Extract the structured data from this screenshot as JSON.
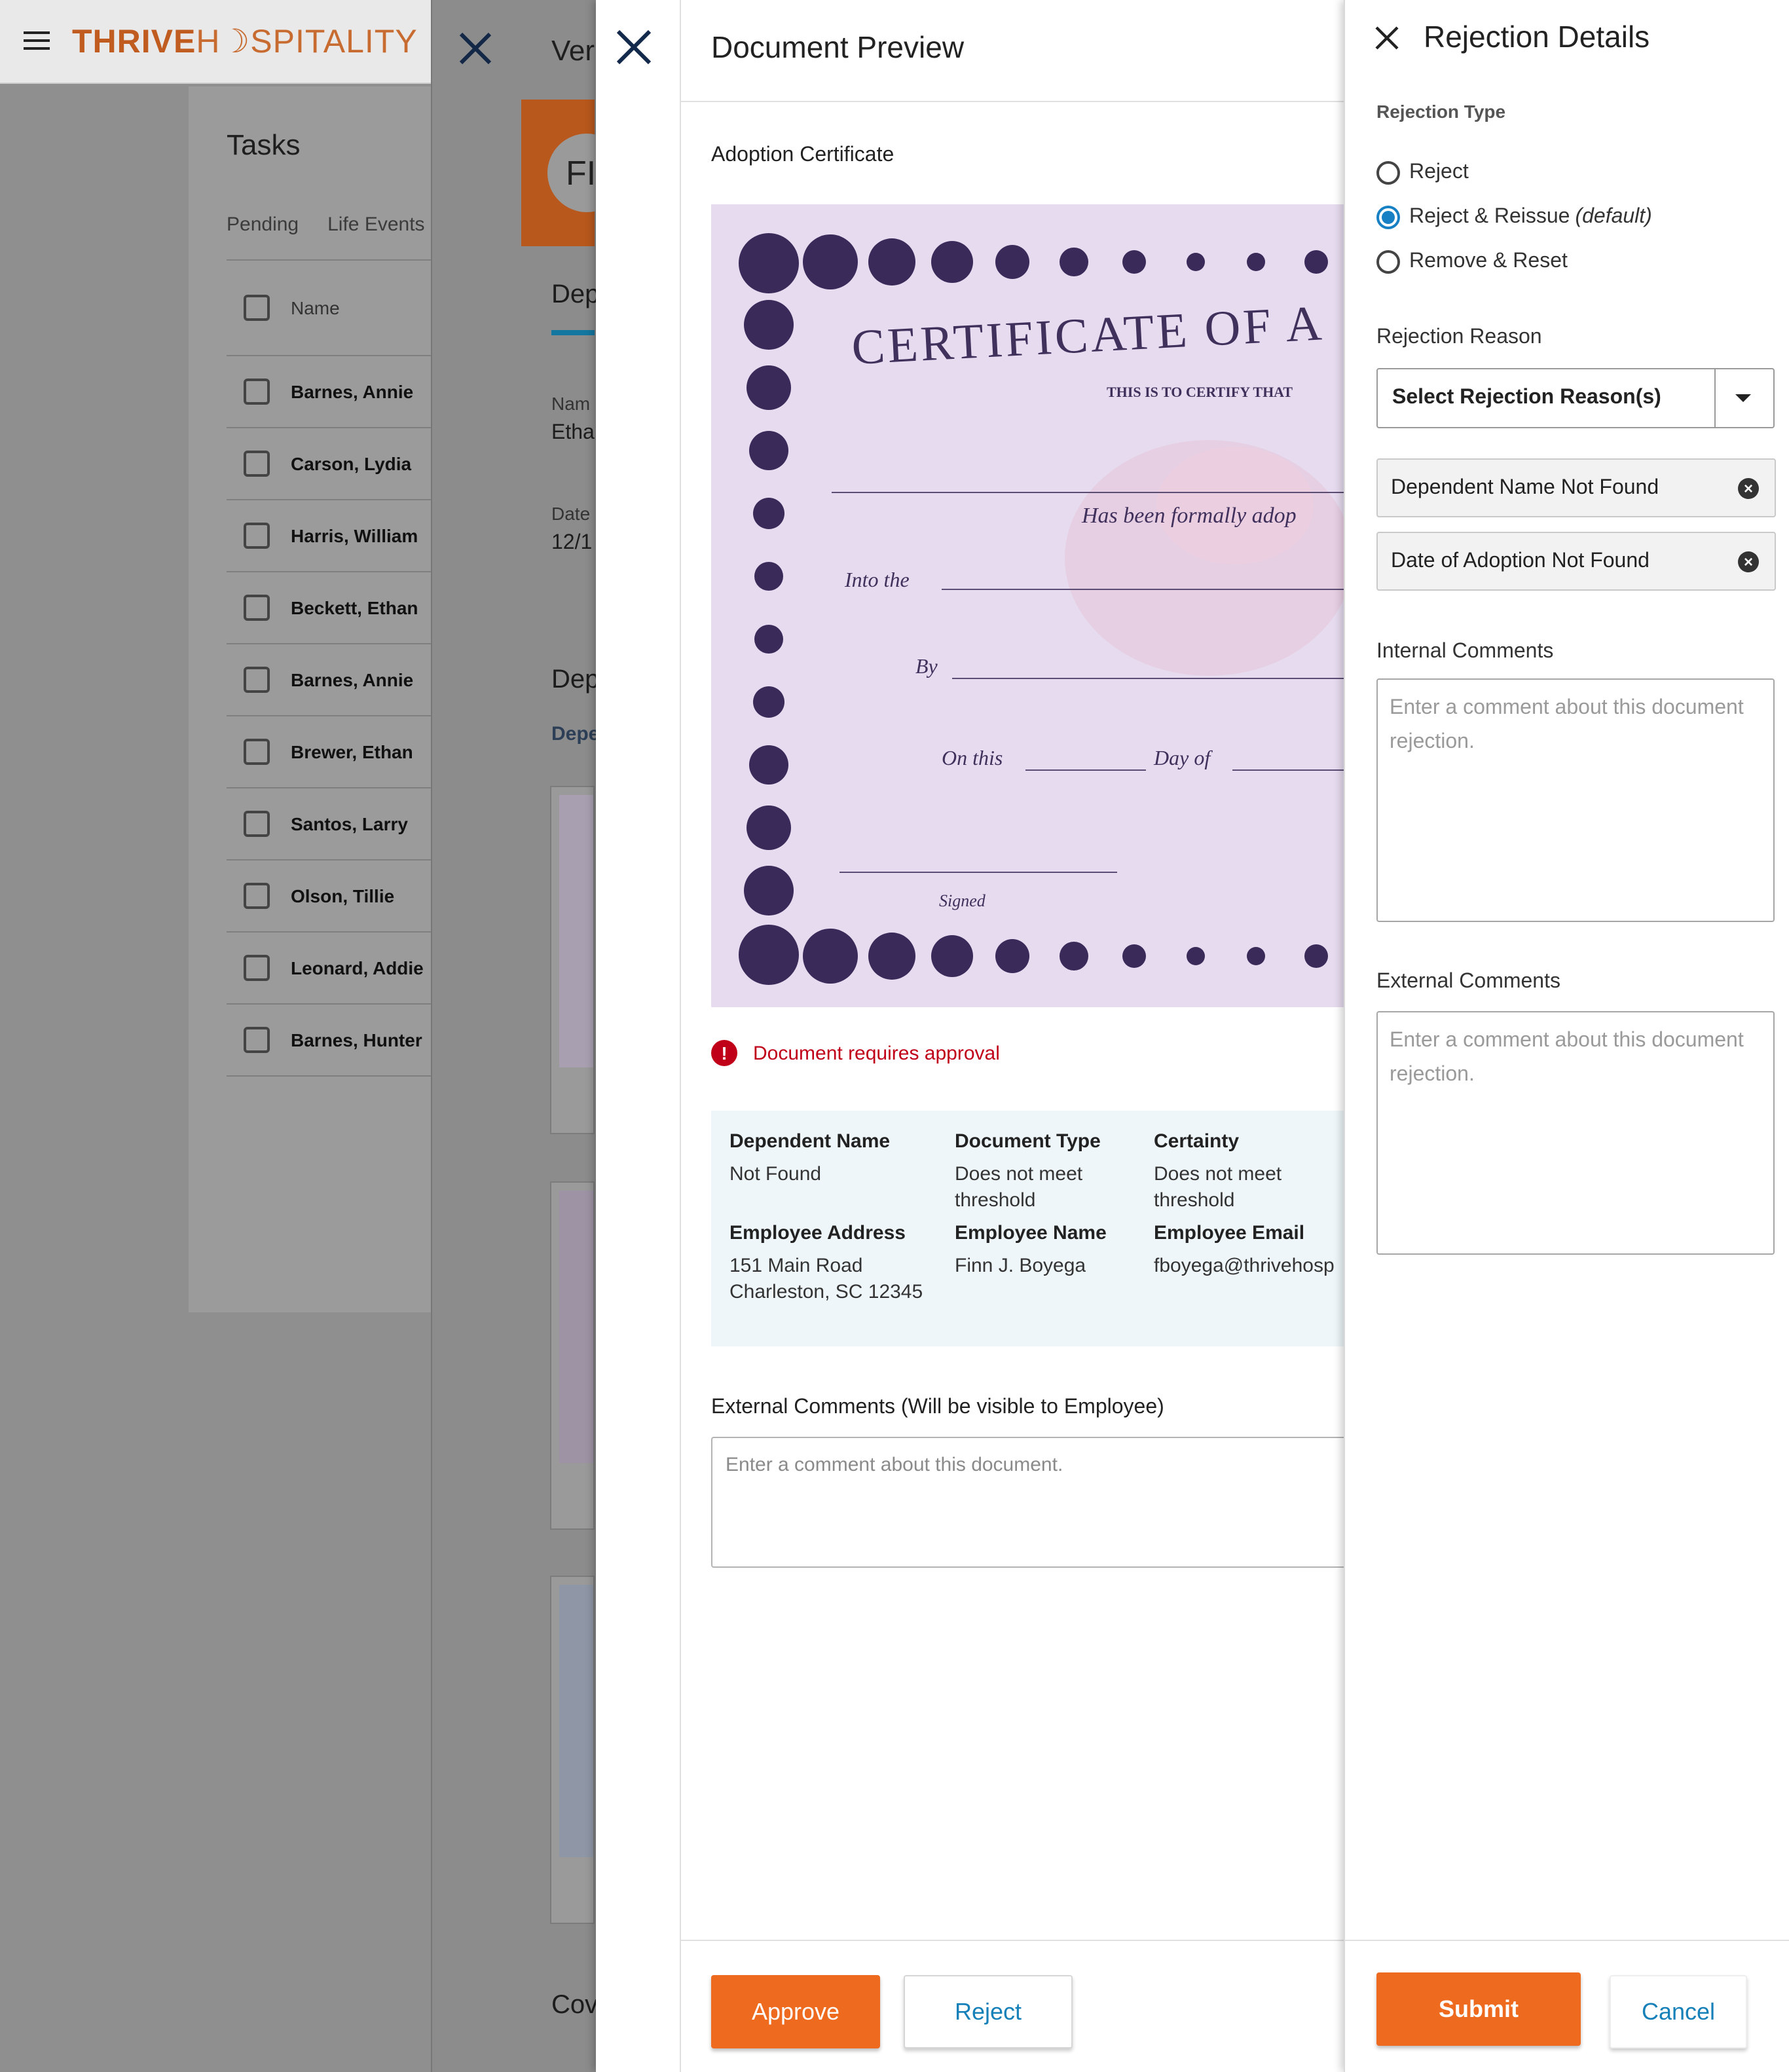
{
  "brand": {
    "part1": "THRIVE",
    "part2": "H☽SPITALITY"
  },
  "tasks": {
    "title": "Tasks",
    "tabs": [
      "Pending",
      "Life Events"
    ],
    "column_name": "Name",
    "rows": [
      "Barnes, Annie",
      "Carson, Lydia",
      "Harris, William",
      "Beckett, Ethan",
      "Barnes, Annie",
      "Brewer, Ethan",
      "Santos, Larry",
      "Olson, Tillie",
      "Leonard, Addie",
      "Barnes, Hunter"
    ]
  },
  "verify_panel": {
    "title_fragment": "Ver",
    "avatar_initials": "FI",
    "tab_fragment": "Dep",
    "name_label": "Nam",
    "name_value": "Etha",
    "date_label": "Date",
    "date_value": "12/1",
    "section_fragment": "Dep",
    "subsection_fragment": "Depe",
    "bottom_fragment": "Cov"
  },
  "preview": {
    "title": "Document Preview",
    "document_label": "Adoption Certificate",
    "certificate": {
      "heading": "CERTIFICATE OF A",
      "subheading": "THIS IS TO CERTIFY THAT",
      "line1": "Has been formally adop",
      "line2": "Into the",
      "line3": "By",
      "line4a": "On this",
      "line4b": "Day of",
      "signed": "Signed"
    },
    "approval_message": "Document requires approval",
    "meta": [
      {
        "label": "Dependent Name",
        "value": "Not Found"
      },
      {
        "label": "Document Type",
        "value": "Does not meet threshold"
      },
      {
        "label": "Certainty",
        "value": "Does not meet threshold"
      },
      {
        "label": "Employee Address",
        "value": "151 Main Road Charleston, SC 12345"
      },
      {
        "label": "Employee Name",
        "value": "Finn J. Boyega"
      },
      {
        "label": "Employee Email",
        "value": "fboyega@thrivehosp"
      }
    ],
    "external_comments_label": "External Comments (Will be visible to Employee)",
    "external_comments_placeholder": "Enter a comment about this document.",
    "approve_label": "Approve",
    "reject_label": "Reject"
  },
  "rejection": {
    "title": "Rejection Details",
    "type_label": "Rejection Type",
    "options": [
      {
        "label": "Reject",
        "note": "",
        "selected": false
      },
      {
        "label": "Reject & Reissue",
        "note": "(default)",
        "selected": true
      },
      {
        "label": "Remove & Reset",
        "note": "",
        "selected": false
      }
    ],
    "reason_label": "Rejection Reason",
    "reason_placeholder": "Select Rejection Reason(s)",
    "selected_reasons": [
      "Dependent Name Not Found",
      "Date of Adoption Not Found"
    ],
    "internal_label": "Internal Comments",
    "internal_placeholder": "Enter a comment about this document rejection.",
    "external_label": "External Comments",
    "external_placeholder": "Enter a comment about this document rejection.",
    "submit_label": "Submit",
    "cancel_label": "Cancel"
  },
  "colors": {
    "accent_orange": "#ee6a1f",
    "link_blue": "#1680b8",
    "error_red": "#c00018",
    "radio_blue": "#1780c4"
  },
  "icons": [
    "menu-icon",
    "close-icon",
    "alert-icon",
    "chevron-down-icon",
    "remove-chip-icon"
  ]
}
